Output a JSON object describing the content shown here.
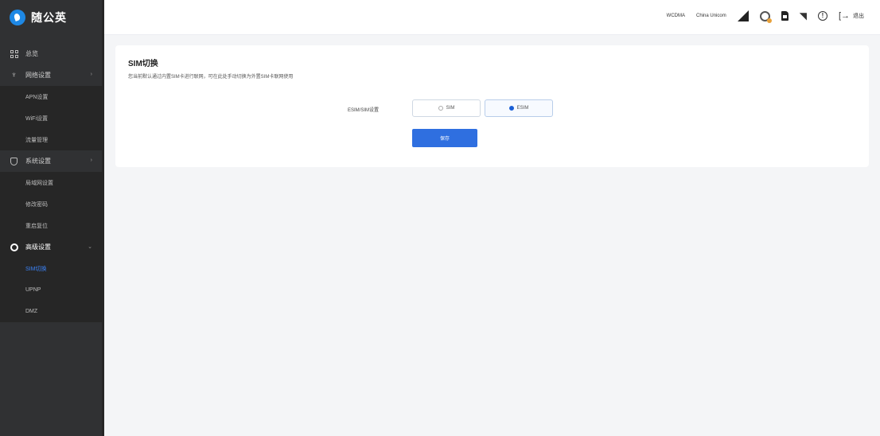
{
  "app": {
    "name": "随公英"
  },
  "sidebar": {
    "items": [
      {
        "label": "总览",
        "icon": "grid-icon"
      },
      {
        "label": "网络设置",
        "icon": "antenna-icon",
        "arrow": "›"
      },
      {
        "label": "APN设置",
        "sub": true
      },
      {
        "label": "WiFi设置",
        "sub": true
      },
      {
        "label": "流量管理",
        "sub": true
      },
      {
        "label": "系统设置",
        "icon": "shield-icon",
        "arrow": "›"
      },
      {
        "label": "局域网设置",
        "sub": true
      },
      {
        "label": "修改密码",
        "sub": true
      },
      {
        "label": "重启复位",
        "sub": true
      },
      {
        "label": "高级设置",
        "icon": "ring-icon",
        "arrow": "⌄"
      },
      {
        "label": "SIM切换",
        "sub": true,
        "active": true
      },
      {
        "label": "UPNP",
        "sub": true
      },
      {
        "label": "DMZ",
        "sub": true
      }
    ]
  },
  "header": {
    "network_type": "WCDMA",
    "carrier": "China Unicom",
    "logout_label": "退出",
    "info_glyph": "!",
    "logout_glyph": "[→",
    "wifi_glyph": "◥"
  },
  "card": {
    "title": "SIM切换",
    "description": "您当前默认通过内置SIM卡进行联网，可在此处手动切换为外置SIM卡联网使用",
    "field_label": "ESIM/SIM设置",
    "options": [
      {
        "label": "SIM",
        "checked": false
      },
      {
        "label": "ESIM",
        "checked": true
      }
    ],
    "save_label": "保存"
  },
  "colors": {
    "sidebar_bg": "#303133",
    "accent": "#2f6fe0",
    "active_text": "#3b82f6",
    "page_bg": "#f4f5f7"
  }
}
